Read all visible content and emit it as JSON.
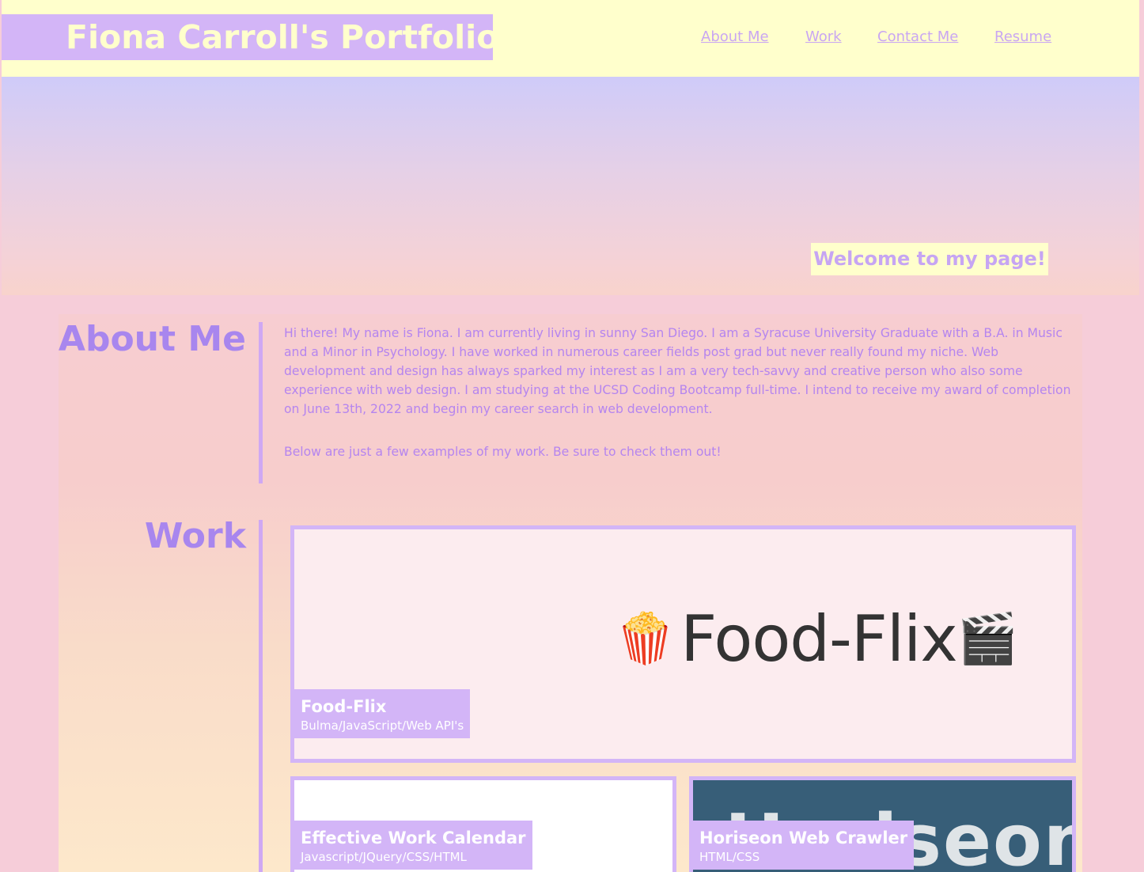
{
  "header": {
    "title": "Fiona Carroll's Portfolio",
    "nav": [
      {
        "label": "About Me"
      },
      {
        "label": "Work"
      },
      {
        "label": "Contact Me"
      },
      {
        "label": "Resume"
      }
    ]
  },
  "hero": {
    "welcome": "Welcome to my page!"
  },
  "about": {
    "heading": "About Me",
    "paragraphs": [
      "Hi there! My name is Fiona. I am currently living in sunny San Diego. I am a Syracuse University Graduate with a B.A. in Music and a Minor in Psychology. I have worked in numerous career fields post grad but never really found my niche. Web development and design has always sparked my interest as I am a very tech-savvy and creative person who also some experience with web design. I am studying at the UCSD Coding Bootcamp full-time. I intend to receive my award of completion on June 13th, 2022 and begin my career search in web development.",
      "Below are just a few examples of my work. Be sure to check them out!"
    ]
  },
  "work": {
    "heading": "Work",
    "projects": [
      {
        "title": "Food-Flix",
        "tech": "Bulma/JavaScript/Web API's",
        "image_text": "Food-Flix",
        "image_icons": [
          "popcorn-icon",
          "clapperboard-icon"
        ]
      },
      {
        "title": "Effective Work Calendar",
        "tech": "Javascript/JQuery/CSS/HTML"
      },
      {
        "title": "Horiseon Web Crawler",
        "tech": "HTML/CSS",
        "image_text": "Horiseon"
      }
    ]
  },
  "colors": {
    "accent_purple": "#d3b5f7",
    "text_purple": "#a886ee",
    "cream": "#ffffcc",
    "background_pink": "#f6cdd9",
    "horiseon_blue": "#375e78"
  }
}
